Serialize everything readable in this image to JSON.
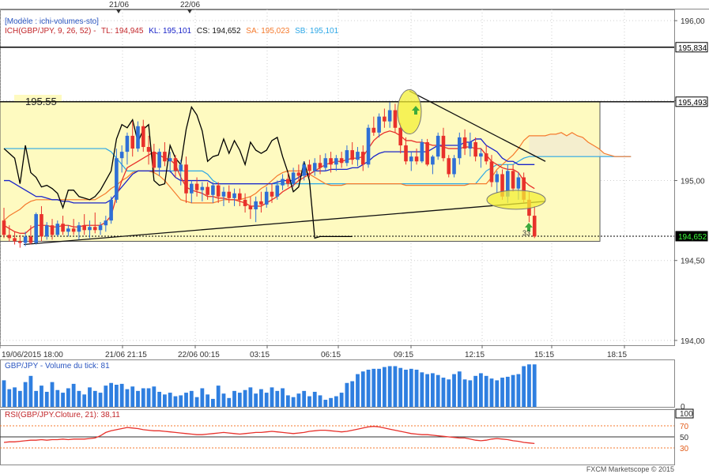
{
  "window": {
    "template_label": "[Modèle : ichi-volumes-sto]"
  },
  "legend": {
    "indicator": "ICH(GBP/JPY, 9, 26, 52) -",
    "tl": "TL: 194,945",
    "kl": "KL: 195,101",
    "cs": "CS: 194,652",
    "sa": "SA: 195,023",
    "sb": "SB: 195,101"
  },
  "colors": {
    "tenkan": "#e8312b",
    "kijun": "#1a24c9",
    "chikou": "#000000",
    "senkou_a": "#f57a2d",
    "senkou_b": "#2aa6e6",
    "cloud": "#f2ebd0",
    "box_fill": "#fefac0",
    "bull": "#2f6fd6",
    "bear": "#e8312b",
    "volume": "#2f7fe0",
    "ellipse": "#f3ef36",
    "rsi": "#e8312b"
  },
  "top_dates": [
    "21/06",
    "22/06"
  ],
  "price_axis": {
    "ticks": [
      "196,00",
      "195,50",
      "195,00",
      "194,50",
      "194,00"
    ],
    "levels": [
      {
        "value": 195.834,
        "label": "195,834"
      },
      {
        "value": 195.493,
        "label": "195,493"
      },
      {
        "value": 194.652,
        "label": "194,652"
      }
    ],
    "range": [
      193.97,
      196.07
    ]
  },
  "time_axis": [
    "19/06/2015 18:00",
    "21/06 21:15",
    "22/06 00:15",
    "03:15",
    "06:15",
    "09:15",
    "12:15",
    "15:15",
    "18:15"
  ],
  "box_label": "195.55",
  "bar_marker": "33",
  "volume_panel": {
    "title": "GBP/JPY - Volume du tick: 81",
    "axis_zero": "0"
  },
  "rsi_panel": {
    "title": "RSI(GBP/JPY.Cloture, 21): 38,11",
    "ticks": [
      "100",
      "70",
      "50",
      "30"
    ]
  },
  "footer": "FXCM Marketscope © 2015",
  "chart_data": {
    "type": "candlestick",
    "title": "",
    "ylabel": "",
    "ylim": [
      193.97,
      196.07
    ],
    "candles": [
      [
        194.75,
        194.83,
        194.64,
        194.66
      ],
      [
        194.66,
        194.72,
        194.62,
        194.64
      ],
      [
        194.64,
        194.68,
        194.6,
        194.62
      ],
      [
        194.62,
        194.66,
        194.58,
        194.61
      ],
      [
        194.61,
        194.68,
        194.59,
        194.65
      ],
      [
        194.65,
        194.72,
        194.6,
        194.61
      ],
      [
        194.61,
        194.8,
        194.6,
        194.79
      ],
      [
        194.79,
        194.84,
        194.62,
        194.65
      ],
      [
        194.65,
        194.74,
        194.63,
        194.72
      ],
      [
        194.72,
        194.76,
        194.63,
        194.66
      ],
      [
        194.66,
        194.75,
        194.65,
        194.73
      ],
      [
        194.73,
        194.78,
        194.66,
        194.68
      ],
      [
        194.68,
        194.72,
        194.65,
        194.7
      ],
      [
        194.7,
        194.76,
        194.66,
        194.68
      ],
      [
        194.68,
        194.74,
        194.63,
        194.72
      ],
      [
        194.72,
        194.79,
        194.66,
        194.69
      ],
      [
        194.69,
        194.75,
        194.64,
        194.71
      ],
      [
        194.71,
        194.8,
        194.67,
        194.69
      ],
      [
        194.69,
        194.74,
        194.66,
        194.72
      ],
      [
        194.72,
        194.78,
        194.68,
        194.75
      ],
      [
        194.75,
        194.9,
        194.73,
        194.88
      ],
      [
        194.88,
        195.2,
        194.86,
        195.14
      ],
      [
        195.14,
        195.22,
        195.05,
        195.18
      ],
      [
        195.18,
        195.3,
        195.1,
        195.28
      ],
      [
        195.28,
        195.37,
        195.15,
        195.2
      ],
      [
        195.2,
        195.37,
        195.18,
        195.34
      ],
      [
        195.34,
        195.38,
        195.18,
        195.21
      ],
      [
        195.21,
        195.28,
        195.1,
        195.18
      ],
      [
        195.18,
        195.23,
        195.05,
        195.08
      ],
      [
        195.08,
        195.2,
        195.03,
        195.18
      ],
      [
        195.18,
        195.24,
        195.09,
        195.12
      ],
      [
        195.12,
        195.18,
        195.05,
        195.14
      ],
      [
        195.14,
        195.16,
        195.02,
        195.06
      ],
      [
        195.06,
        195.13,
        194.97,
        195.1
      ],
      [
        195.1,
        195.15,
        194.86,
        194.92
      ],
      [
        194.92,
        195.0,
        194.86,
        194.98
      ],
      [
        194.98,
        195.02,
        194.9,
        194.94
      ],
      [
        194.94,
        194.99,
        194.87,
        194.96
      ],
      [
        194.96,
        194.99,
        194.88,
        194.91
      ],
      [
        194.91,
        194.99,
        194.86,
        194.97
      ],
      [
        194.97,
        194.99,
        194.86,
        194.9
      ],
      [
        194.9,
        194.96,
        194.84,
        194.93
      ],
      [
        194.93,
        194.97,
        194.86,
        194.89
      ],
      [
        194.89,
        194.95,
        194.84,
        194.92
      ],
      [
        194.92,
        194.95,
        194.84,
        194.88
      ],
      [
        194.88,
        194.92,
        194.8,
        194.84
      ],
      [
        194.84,
        194.9,
        194.76,
        194.82
      ],
      [
        194.82,
        194.9,
        194.74,
        194.87
      ],
      [
        194.87,
        194.93,
        194.8,
        194.85
      ],
      [
        194.85,
        194.96,
        194.83,
        194.93
      ],
      [
        194.93,
        194.98,
        194.86,
        194.9
      ],
      [
        194.9,
        195.0,
        194.88,
        194.97
      ],
      [
        194.97,
        195.04,
        194.94,
        195.01
      ],
      [
        195.01,
        195.05,
        194.96,
        194.98
      ],
      [
        194.98,
        195.08,
        194.96,
        195.05
      ],
      [
        195.05,
        195.1,
        195.0,
        195.03
      ],
      [
        195.03,
        195.12,
        195.0,
        195.1
      ],
      [
        195.1,
        195.13,
        195.02,
        195.06
      ],
      [
        195.06,
        195.14,
        195.03,
        195.11
      ],
      [
        195.11,
        195.16,
        195.04,
        195.08
      ],
      [
        195.08,
        195.17,
        195.06,
        195.14
      ],
      [
        195.14,
        195.18,
        195.05,
        195.1
      ],
      [
        195.1,
        195.16,
        195.06,
        195.14
      ],
      [
        195.14,
        195.18,
        195.08,
        195.11
      ],
      [
        195.11,
        195.22,
        195.09,
        195.19
      ],
      [
        195.19,
        195.24,
        195.1,
        195.13
      ],
      [
        195.13,
        195.21,
        195.09,
        195.18
      ],
      [
        195.18,
        195.22,
        195.06,
        195.1
      ],
      [
        195.1,
        195.35,
        195.08,
        195.33
      ],
      [
        195.33,
        195.4,
        195.28,
        195.3
      ],
      [
        195.3,
        195.42,
        195.27,
        195.4
      ],
      [
        195.4,
        195.45,
        195.33,
        195.37
      ],
      [
        195.37,
        195.49,
        195.33,
        195.44
      ],
      [
        195.44,
        195.48,
        195.3,
        195.33
      ],
      [
        195.33,
        195.36,
        195.17,
        195.22
      ],
      [
        195.22,
        195.27,
        195.1,
        195.12
      ],
      [
        195.12,
        195.18,
        195.06,
        195.15
      ],
      [
        195.15,
        195.2,
        195.1,
        195.12
      ],
      [
        195.12,
        195.26,
        195.11,
        195.24
      ],
      [
        195.24,
        195.26,
        195.09,
        195.1
      ],
      [
        195.1,
        195.16,
        195.04,
        195.15
      ],
      [
        195.15,
        195.3,
        195.13,
        195.28
      ],
      [
        195.28,
        195.33,
        195.12,
        195.14
      ],
      [
        195.14,
        195.16,
        195.02,
        195.04
      ],
      [
        195.04,
        195.16,
        195.02,
        195.14
      ],
      [
        195.14,
        195.3,
        195.1,
        195.27
      ],
      [
        195.27,
        195.32,
        195.16,
        195.2
      ],
      [
        195.2,
        195.3,
        195.15,
        195.24
      ],
      [
        195.24,
        195.27,
        195.12,
        195.15
      ],
      [
        195.15,
        195.2,
        195.08,
        195.17
      ],
      [
        195.17,
        195.22,
        195.1,
        195.12
      ],
      [
        195.12,
        195.16,
        194.96,
        194.99
      ],
      [
        194.99,
        195.06,
        194.92,
        195.04
      ],
      [
        195.04,
        195.07,
        194.88,
        194.9
      ],
      [
        194.9,
        195.1,
        194.86,
        195.06
      ],
      [
        195.06,
        195.1,
        194.93,
        194.95
      ],
      [
        194.95,
        195.05,
        194.88,
        195.02
      ],
      [
        195.02,
        195.05,
        194.86,
        194.88
      ],
      [
        194.88,
        194.93,
        194.74,
        194.78
      ],
      [
        194.78,
        194.84,
        194.64,
        194.65
      ]
    ],
    "tenkan_sen": [
      194.72,
      194.7,
      194.68,
      194.67,
      194.67,
      194.7,
      194.72,
      194.72,
      194.72,
      194.71,
      194.71,
      194.72,
      194.72,
      194.71,
      194.71,
      194.72,
      194.72,
      194.72,
      194.72,
      194.74,
      194.78,
      194.9,
      195.0,
      195.08,
      195.1,
      195.12,
      195.14,
      195.16,
      195.18,
      195.16,
      195.14,
      195.13,
      195.1,
      195.02,
      194.96,
      194.94,
      194.93,
      194.92,
      194.9,
      194.9,
      194.89,
      194.89,
      194.88,
      194.88,
      194.87,
      194.86,
      194.84,
      194.84,
      194.84,
      194.86,
      194.88,
      194.9,
      194.93,
      194.95,
      194.97,
      195.0,
      195.02,
      195.04,
      195.06,
      195.08,
      195.1,
      195.11,
      195.12,
      195.12,
      195.13,
      195.14,
      195.14,
      195.15,
      195.2,
      195.25,
      195.28,
      195.3,
      195.31,
      195.3,
      195.28,
      195.25,
      195.25,
      195.24,
      195.24,
      195.23,
      195.22,
      195.22,
      195.21,
      195.2,
      195.2,
      195.2,
      195.21,
      195.21,
      195.2,
      195.2,
      195.16,
      195.12,
      195.1,
      195.08,
      195.07,
      195.07,
      195.05,
      195.0,
      194.97,
      194.95
    ],
    "kijun_sen": [
      195.0,
      195.0,
      194.98,
      194.96,
      194.94,
      194.92,
      194.9,
      194.9,
      194.89,
      194.88,
      194.88,
      194.87,
      194.87,
      194.86,
      194.86,
      194.86,
      194.86,
      194.86,
      194.86,
      194.86,
      194.88,
      194.92,
      194.96,
      195.0,
      195.04,
      195.06,
      195.06,
      195.06,
      195.06,
      195.06,
      195.06,
      195.06,
      195.02,
      195.0,
      195.0,
      195.0,
      195.0,
      195.0,
      195.0,
      194.98,
      194.98,
      194.98,
      194.98,
      194.98,
      194.98,
      194.98,
      194.98,
      194.98,
      194.98,
      194.98,
      194.98,
      194.99,
      195.0,
      195.0,
      195.0,
      195.02,
      195.04,
      195.04,
      195.06,
      195.06,
      195.06,
      195.07,
      195.07,
      195.07,
      195.07,
      195.08,
      195.08,
      195.1,
      195.12,
      195.15,
      195.17,
      195.18,
      195.18,
      195.18,
      195.18,
      195.18,
      195.18,
      195.18,
      195.18,
      195.18,
      195.2,
      195.22,
      195.22,
      195.22,
      195.22,
      195.22,
      195.24,
      195.24,
      195.26,
      195.26,
      195.22,
      195.2,
      195.18,
      195.14,
      195.12,
      195.12,
      195.1,
      195.1,
      195.1,
      195.1
    ],
    "senkou_a": [
      194.75,
      194.78,
      194.8,
      194.82,
      194.85,
      194.87,
      194.88,
      194.88,
      194.88,
      194.88,
      194.88,
      194.88,
      194.88,
      194.88,
      194.88,
      194.88,
      194.88,
      194.88,
      194.9,
      194.92,
      194.95,
      194.97,
      195.0,
      195.02,
      195.05,
      195.06,
      195.06,
      195.06,
      195.05,
      195.03,
      195.0,
      194.96,
      194.92,
      194.88,
      194.87,
      194.86,
      194.86,
      194.86,
      194.86,
      194.86,
      194.87,
      194.88,
      194.88,
      194.88,
      194.88,
      194.89,
      194.9,
      194.92,
      194.95,
      194.97,
      195.0,
      195.03,
      195.05,
      195.06,
      195.06,
      195.06,
      195.06,
      195.04,
      195.02,
      195.0,
      194.98,
      194.97,
      194.97,
      194.97,
      194.98,
      194.98,
      194.98,
      194.98,
      194.98,
      194.98,
      194.98,
      194.98,
      194.98,
      194.98,
      194.98,
      194.97,
      194.97,
      194.97,
      194.97,
      194.97,
      194.97,
      194.97,
      194.97,
      194.97,
      194.97,
      194.97,
      194.97,
      194.98,
      194.98,
      194.98,
      194.98,
      195.02,
      195.07,
      195.1,
      195.13,
      195.16,
      195.2,
      195.25,
      195.28,
      195.28,
      195.28,
      195.28,
      195.29,
      195.29,
      195.3,
      195.28,
      195.3,
      195.28,
      195.27,
      195.24,
      195.22,
      195.2,
      195.17,
      195.16,
      195.15,
      195.15,
      195.15,
      195.15
    ],
    "senkou_b": [
      195.2,
      195.2,
      195.2,
      195.2,
      195.2,
      195.2,
      195.2,
      195.2,
      195.2,
      195.2,
      195.2,
      195.2,
      195.2,
      195.2,
      195.2,
      195.2,
      195.2,
      195.2,
      195.2,
      195.2,
      195.18,
      195.14,
      195.1,
      195.06,
      195.06,
      195.06,
      195.06,
      195.06,
      195.06,
      195.06,
      195.06,
      195.06,
      195.06,
      195.06,
      195.06,
      195.06,
      195.06,
      195.06,
      195.04,
      195.0,
      194.98,
      194.98,
      194.98,
      194.98,
      194.98,
      194.98,
      194.98,
      194.98,
      194.98,
      194.98,
      194.98,
      194.98,
      194.98,
      194.98,
      194.98,
      194.98,
      194.98,
      194.98,
      194.98,
      194.98,
      194.98,
      194.98,
      194.98,
      194.98,
      194.98,
      194.98,
      194.98,
      194.98,
      194.98,
      194.98,
      194.98,
      194.98,
      194.98,
      194.98,
      194.98,
      194.98,
      194.98,
      194.98,
      194.98,
      194.98,
      194.98,
      194.98,
      194.98,
      194.98,
      194.98,
      194.98,
      194.98,
      194.98,
      194.98,
      195.02,
      195.06,
      195.08,
      195.1,
      195.1,
      195.1,
      195.1,
      195.12,
      195.14,
      195.15,
      195.15,
      195.15,
      195.15,
      195.15,
      195.15,
      195.15,
      195.15,
      195.15,
      195.15,
      195.15,
      195.15,
      195.15,
      195.15,
      195.15,
      195.15,
      195.15,
      195.15,
      195.15,
      195.15
    ],
    "chikou_span": [
      195.2,
      195.17,
      195.14,
      194.98,
      195.22,
      195.05,
      195.02,
      194.96,
      194.97,
      194.95,
      194.92,
      194.83,
      194.94,
      194.94,
      194.9,
      194.89,
      194.88,
      194.9,
      194.94,
      195.0,
      195.06,
      195.26,
      195.35,
      195.33,
      195.38,
      195.24,
      195.32,
      195.35,
      195.0,
      194.97,
      194.98,
      195.22,
      195.14,
      195.1,
      195.32,
      195.46,
      195.41,
      195.31,
      195.12,
      195.15,
      195.16,
      195.26,
      195.17,
      195.25,
      195.19,
      195.1,
      195.24,
      195.19,
      195.17,
      195.19,
      195.25,
      195.27,
      195.15,
      195.05,
      194.93,
      194.96,
      195.12,
      195.0,
      194.64,
      194.65,
      194.65,
      194.65,
      194.65,
      194.65,
      194.65,
      194.65
    ],
    "volume": [
      30,
      20,
      22,
      18,
      28,
      35,
      18,
      24,
      17,
      28,
      19,
      16,
      21,
      26,
      18,
      14,
      22,
      18,
      16,
      24,
      27,
      25,
      26,
      20,
      23,
      18,
      21,
      21,
      23,
      17,
      14,
      16,
      12,
      13,
      16,
      18,
      11,
      21,
      14,
      9,
      24,
      15,
      10,
      18,
      16,
      19,
      22,
      15,
      20,
      16,
      22,
      18,
      21,
      13,
      11,
      15,
      18,
      12,
      17,
      13,
      8,
      10,
      12,
      16,
      27,
      29,
      37,
      40,
      42,
      43,
      43,
      45,
      46,
      46,
      44,
      42,
      43,
      42,
      39,
      37,
      38,
      36,
      33,
      31,
      37,
      40,
      31,
      30,
      35,
      38,
      35,
      32,
      30,
      33,
      34,
      36,
      37,
      46,
      48,
      48
    ],
    "volume_ylim": [
      0,
      50
    ],
    "rsi": [
      40,
      41,
      41,
      42,
      43,
      44,
      44,
      45,
      44,
      45,
      45,
      46,
      45,
      46,
      46,
      46,
      47,
      48,
      52,
      58,
      61,
      63,
      65,
      67,
      66,
      65,
      63,
      62,
      61,
      61,
      60,
      59,
      58,
      57,
      56,
      55,
      54,
      54,
      55,
      56,
      57,
      58,
      57,
      56,
      55,
      56,
      57,
      58,
      58,
      59,
      60,
      59,
      58,
      57,
      56,
      57,
      58,
      60,
      61,
      62,
      62,
      61,
      60,
      59,
      60,
      62,
      64,
      66,
      68,
      69,
      68,
      66,
      64,
      62,
      60,
      58,
      56,
      55,
      54,
      54,
      53,
      52,
      51,
      50,
      49,
      48,
      48,
      46,
      44,
      43,
      44,
      46,
      47,
      46,
      45,
      43,
      42,
      40,
      39,
      38
    ],
    "rsi_ylim": [
      0,
      100
    ],
    "rsi_levels": [
      70,
      50,
      30
    ],
    "time_labels": [
      "19/06/2015 18:00",
      "21/06 21:15",
      "22/06 00:15",
      "03:15",
      "06:15",
      "09:15",
      "12:15",
      "15:15",
      "18:15"
    ],
    "grid": true
  }
}
